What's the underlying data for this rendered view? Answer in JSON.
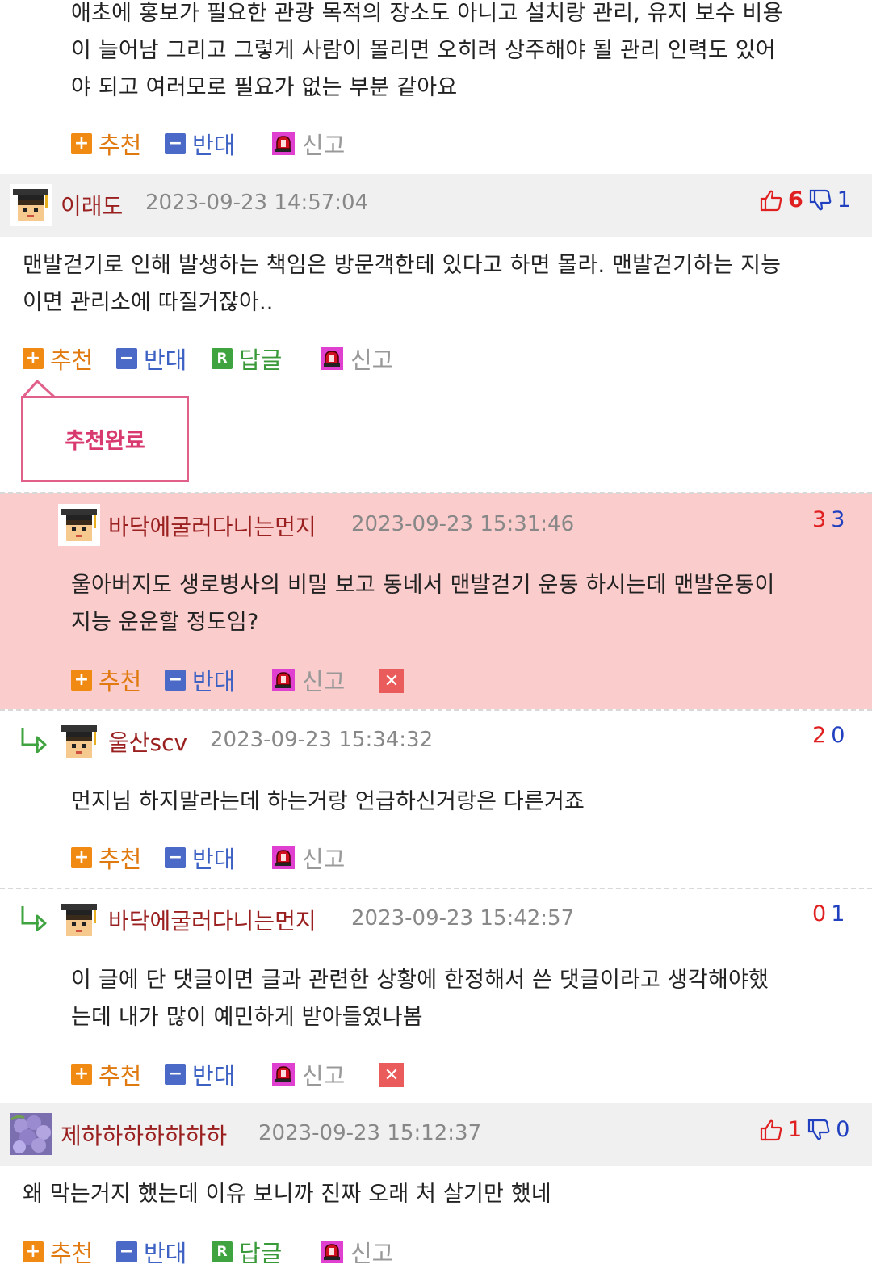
{
  "post0": {
    "text_lines": [
      "애초에 홍보가 필요한 관광 목적의 장소도 아니고 설치랑 관리, 유지 보수 비용",
      "이 늘어남 그리고 그렇게 사람이 몰리면 오히려 상주해야 될 관리 인력도 있어",
      "야 되고 여러모로 필요가 없는 부분 같아요"
    ]
  },
  "actions": {
    "recommend": "추천",
    "oppose": "반대",
    "reply": "답글",
    "report": "신고",
    "reply_icon": "R"
  },
  "comment1": {
    "author": "이래도",
    "time": "2023-09-23 14:57:04",
    "up": "6",
    "down": "1",
    "text_lines": [
      "맨발걷기로 인해 발생하는 책임은 방문객한테 있다고 하면 몰라. 맨발걷기하는 지능",
      "이면 관리소에 따질거잖아.."
    ],
    "tooltip": "추천완료"
  },
  "reply1": {
    "author": "바닥에굴러다니는먼지",
    "time": "2023-09-23 15:31:46",
    "up": "3",
    "down": "3",
    "text_lines": [
      "울아버지도 생로병사의 비밀 보고 동네서 맨발걷기 운동 하시는데 맨발운동이",
      "지능 운운할 정도임?"
    ]
  },
  "reply2": {
    "author": "울산scv",
    "time": "2023-09-23 15:34:32",
    "up": "2",
    "down": "0",
    "text_lines": [
      "먼지님 하지말라는데 하는거랑 언급하신거랑은 다른거죠"
    ]
  },
  "reply3": {
    "author": "바닥에굴러다니는먼지",
    "time": "2023-09-23 15:42:57",
    "up": "0",
    "down": "1",
    "text_lines": [
      "이 글에 단 댓글이면 글과 관련한 상황에 한정해서 쓴 댓글이라고 생각해야했",
      "는데 내가 많이 예민하게 받아들였나봄"
    ]
  },
  "comment2": {
    "author": "제하하하하하하하",
    "time": "2023-09-23 15:12:37",
    "up": "1",
    "down": "0",
    "text_lines": [
      "왜 막는거지 했는데 이유 보니까 진짜 오래 처 살기만 했네"
    ]
  },
  "colors": {
    "highlight_bg": "#fbcccc",
    "header_bg": "#f0f0f0",
    "name": "#9a1f1f",
    "up": "#e02020",
    "down": "#2040c0",
    "tooltip_border": "#e0608a"
  }
}
